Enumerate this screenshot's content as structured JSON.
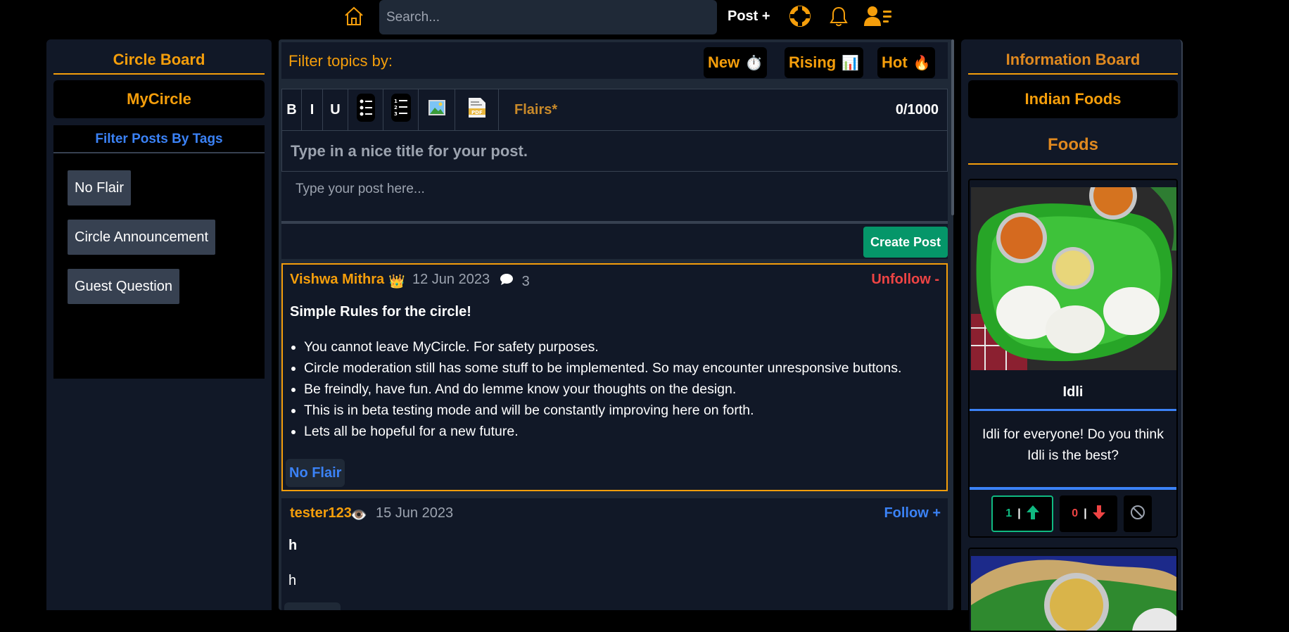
{
  "topbar": {
    "search_placeholder": "Search...",
    "post_label": "Post +",
    "icons": [
      "home-icon",
      "lifebuoy-icon",
      "bell-icon",
      "user-menu-icon"
    ],
    "accent": "#f59e0b"
  },
  "left": {
    "board_title": "Circle Board",
    "circle_name": "MyCircle",
    "tags_title": "Filter Posts By Tags",
    "tags": [
      "No Flair",
      "Circle Announcement",
      "Guest Question"
    ]
  },
  "center": {
    "filter_label": "Filter topics by:",
    "sort": [
      {
        "label": "New",
        "icon": "⏱️"
      },
      {
        "label": "Rising",
        "icon": "📊"
      },
      {
        "label": "Hot",
        "icon": "🔥"
      }
    ],
    "toolbar": {
      "bold": "B",
      "italic": "I",
      "underline": "U",
      "flairs": "Flairs*",
      "char_count": "0/1000"
    },
    "title_placeholder": "Type in a nice title for your post.",
    "body_placeholder": "Type your post here...",
    "create_label": "Create Post",
    "posts": [
      {
        "author": "Vishwa Mithra",
        "author_icon": "👑",
        "date": "12 Jun 2023",
        "comments": "3",
        "follow": "Unfollow -",
        "title": "Simple Rules for the circle!",
        "bullets": [
          "You cannot leave MyCircle. For safety purposes.",
          "Circle moderation still has some stuff to be implemented. So may encounter unresponsive buttons.",
          "Be freindly, have fun. And do lemme know your thoughts on the design.",
          "This is in beta testing mode and will be constantly improving here on forth.",
          "Lets all be hopeful for a new future."
        ],
        "flair": "No Flair"
      },
      {
        "author": "tester123",
        "author_icon": "👁️",
        "date": "15 Jun 2023",
        "follow": "Follow +",
        "title": "h",
        "body": "h"
      }
    ]
  },
  "right": {
    "board_title": "Information Board",
    "board_name": "Indian Foods",
    "section_title": "Foods",
    "food": {
      "name": "Idli",
      "description": "Idli for everyone! Do you think Idli is the best?",
      "upvotes": "1",
      "downvotes": "0"
    }
  }
}
